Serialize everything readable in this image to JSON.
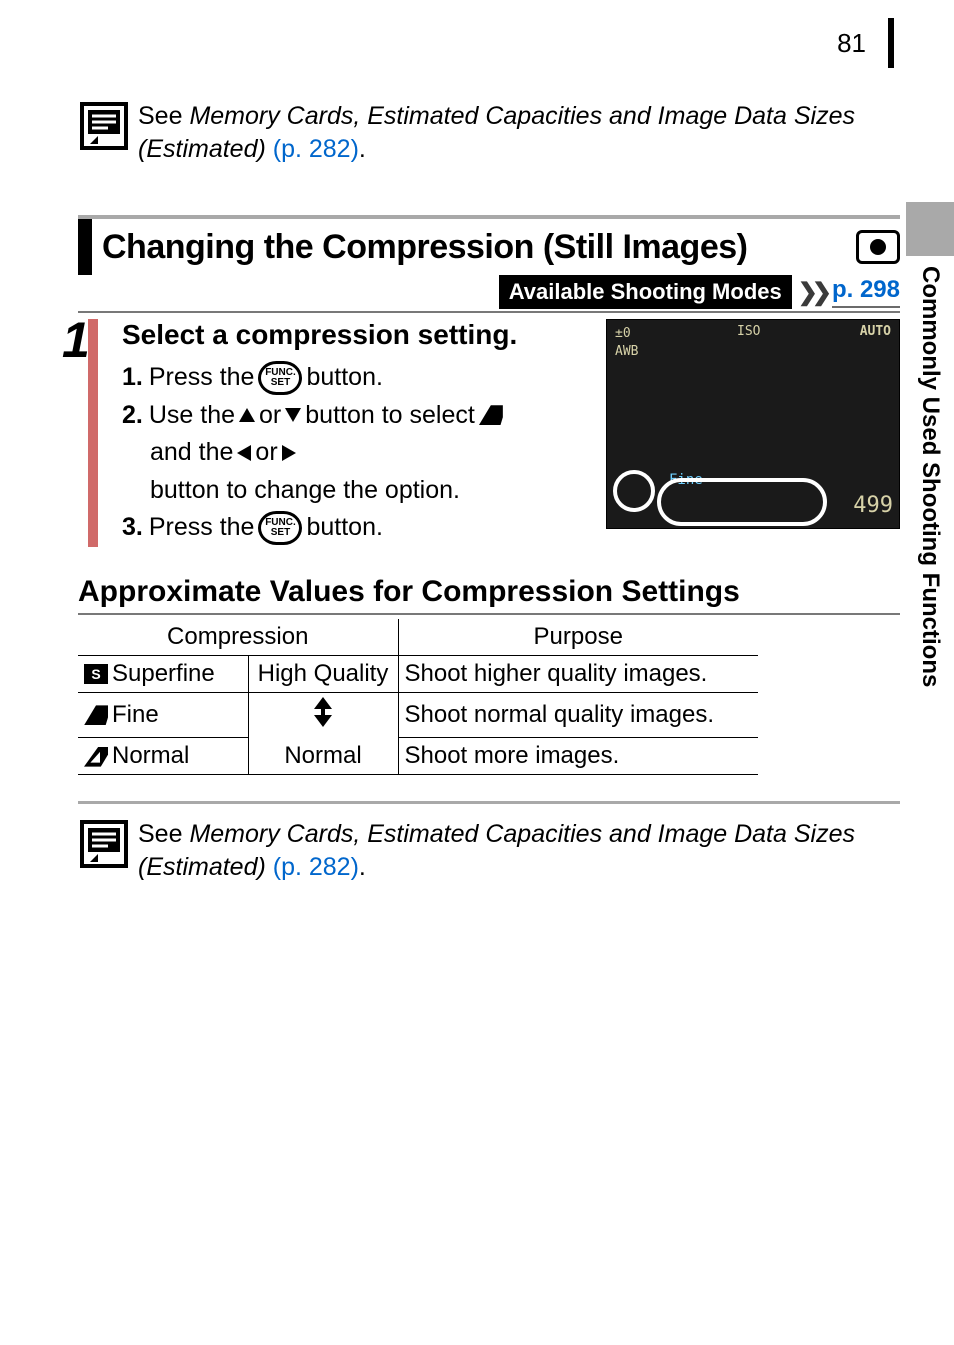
{
  "page_number": "81",
  "side_tab": "Commonly Used Shooting Functions",
  "note_top": {
    "prefix": "See ",
    "ref_title": "Memory Cards, Estimated Capacities and Image Data Sizes (Estimated)",
    "ref_link": " (p. 282)",
    "suffix": "."
  },
  "section": {
    "title": "Changing the Compression (Still Images)",
    "modes_label": "Available Shooting Modes",
    "modes_link": "p. 298"
  },
  "step": {
    "number": "1",
    "title": "Select a compression setting.",
    "li1_num": "1.",
    "li1_a": "Press the ",
    "li1_b": " button.",
    "li2_num": "2.",
    "li2_a": "Use the ",
    "li2_b": " or ",
    "li2_c": " button to select ",
    "li2_d": "and the ",
    "li2_e": " or ",
    "li2_f": " button to change the option.",
    "li3_num": "3.",
    "li3_a": "Press the ",
    "li3_b": " button.",
    "func_top": "FUNC.",
    "func_bot": "SET"
  },
  "screenshot": {
    "fine_label": "Fine",
    "count": "499",
    "auto": "AUTO",
    "iso": "ISO",
    "awb": "AWB"
  },
  "table_heading": "Approximate Values for Compression Settings",
  "table": {
    "h1": "Compression",
    "h2": "Purpose",
    "r1c1": "Superfine",
    "r1c2": "High Quality",
    "r1c3": "Shoot higher quality images.",
    "r2c1": "Fine",
    "r2c3": "Shoot normal quality images.",
    "r3c1": "Normal",
    "r3c2": "Normal",
    "r3c3": "Shoot more images."
  },
  "note_bottom": {
    "prefix": "See ",
    "ref_title": "Memory Cards, Estimated Capacities and Image Data Sizes (Estimated)",
    "ref_link": " (p. 282)",
    "suffix": "."
  }
}
